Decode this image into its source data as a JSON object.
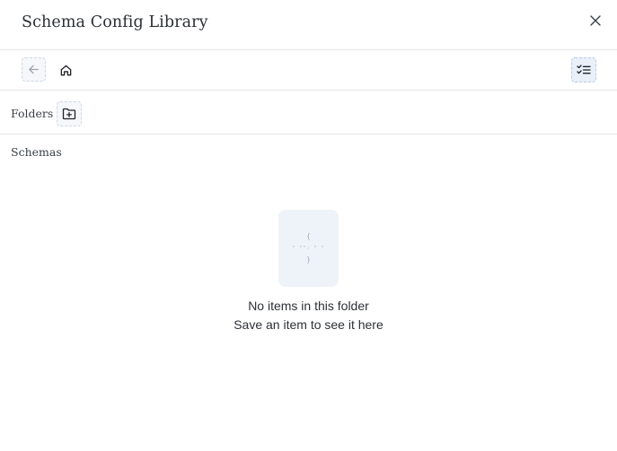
{
  "dialog": {
    "title": "Schema Config Library",
    "close_icon": "close-icon"
  },
  "toolbar": {
    "back_icon": "arrow-left-icon",
    "home_icon": "home-icon",
    "select_icon": "checklist-icon"
  },
  "folders": {
    "label": "Folders",
    "add_icon": "folder-plus-icon"
  },
  "schemas": {
    "label": "Schemas"
  },
  "empty_state": {
    "icon": "json-file-icon",
    "icon_glyph_top": "{",
    "icon_glyph_mid": "\" \"\": \" \"",
    "icon_glyph_bottom": "}",
    "title": "No items in this folder",
    "subtitle": "Save an item to see it here"
  },
  "colors": {
    "accent_bg": "#e9f0f8",
    "border": "#e3e5e8",
    "placeholder_bg": "#eef3f9"
  }
}
